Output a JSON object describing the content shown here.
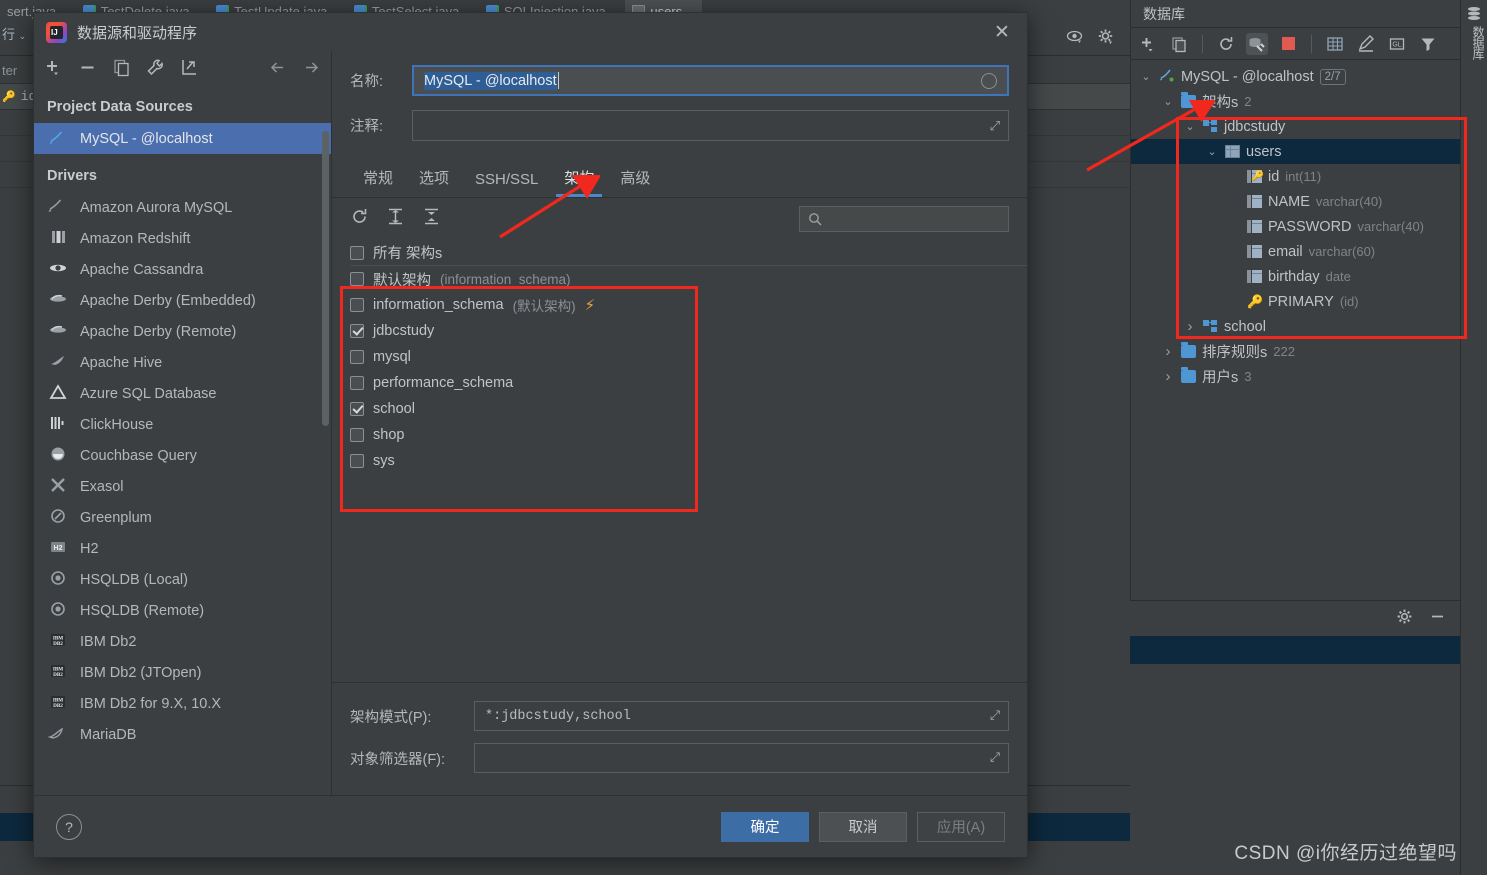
{
  "ide": {
    "editor_tabs": [
      {
        "label": "sert.java",
        "icon": "java-file-icon",
        "active": false
      },
      {
        "label": "TestDelete.java",
        "icon": "java-file-icon",
        "active": false
      },
      {
        "label": "TestUpdate.java",
        "icon": "java-file-icon",
        "active": false
      },
      {
        "label": "TestSelect.java",
        "icon": "java-file-icon",
        "active": false
      },
      {
        "label": "SQLInjection.java",
        "icon": "java-file-icon",
        "active": false
      },
      {
        "label": "users",
        "icon": "table-icon",
        "active": true
      }
    ],
    "grid_behind": {
      "rows_label": "行",
      "filter_label": "ter",
      "column": "id"
    }
  },
  "db_panel": {
    "title": "数据库",
    "rail_label": "数据库",
    "head_icons": [
      "locate-icon",
      "expand-all-icon",
      "collapse-all-icon",
      "gear-icon",
      "minimize-icon"
    ],
    "toolbar_icons": [
      "add-icon",
      "copy-icon",
      "refresh-icon",
      "datasource-properties-icon",
      "stop-icon",
      "table-editor-icon",
      "edit-icon",
      "query-console-icon",
      "filter-icon"
    ],
    "tree": [
      {
        "depth": 0,
        "twisty": "down",
        "icon": "mysql-icon",
        "label": "MySQL - @localhost",
        "badge": "2/7",
        "selected": false
      },
      {
        "depth": 1,
        "twisty": "down",
        "icon": "folder-icon",
        "label": "架构s",
        "sub": "2",
        "selected": false
      },
      {
        "depth": 2,
        "twisty": "down",
        "icon": "schema-icon",
        "label": "jdbcstudy",
        "selected": false
      },
      {
        "depth": 3,
        "twisty": "down",
        "icon": "table-icon",
        "label": "users",
        "selected": true
      },
      {
        "depth": 4,
        "twisty": "none",
        "icon": "primary-key-column-icon",
        "label": "id",
        "sub": "int(11)",
        "selected": false
      },
      {
        "depth": 4,
        "twisty": "none",
        "icon": "column-icon",
        "label": "NAME",
        "sub": "varchar(40)",
        "selected": false
      },
      {
        "depth": 4,
        "twisty": "none",
        "icon": "column-icon",
        "label": "PASSWORD",
        "sub": "varchar(40)",
        "selected": false
      },
      {
        "depth": 4,
        "twisty": "none",
        "icon": "column-icon",
        "label": "email",
        "sub": "varchar(60)",
        "selected": false
      },
      {
        "depth": 4,
        "twisty": "none",
        "icon": "column-icon",
        "label": "birthday",
        "sub": "date",
        "selected": false
      },
      {
        "depth": 4,
        "twisty": "none",
        "icon": "key-icon",
        "label": "PRIMARY",
        "sub": "(id)",
        "selected": false
      },
      {
        "depth": 2,
        "twisty": "right",
        "icon": "schema-icon",
        "label": "school",
        "selected": false
      },
      {
        "depth": 1,
        "twisty": "right",
        "icon": "folder-icon",
        "label": "排序规则s",
        "sub": "222",
        "selected": false
      },
      {
        "depth": 1,
        "twisty": "right",
        "icon": "folder-icon",
        "label": "用户s",
        "sub": "3",
        "selected": false
      }
    ]
  },
  "dialog": {
    "title": "数据源和驱动程序",
    "close_label": "✕",
    "left": {
      "toolbar_icons": [
        "add-icon",
        "remove-icon",
        "copy-icon",
        "wrench-icon",
        "import-icon",
        "back-arrow-icon",
        "forward-arrow-icon"
      ],
      "project_header": "Project Data Sources",
      "datasources": [
        {
          "label": "MySQL - @localhost",
          "icon": "mysql-icon",
          "selected": true
        }
      ],
      "drivers_header": "Drivers",
      "drivers": [
        {
          "label": "Amazon Aurora MySQL",
          "icon": "mysql-dolphin-icon"
        },
        {
          "label": "Amazon Redshift",
          "icon": "redshift-icon"
        },
        {
          "label": "Apache Cassandra",
          "icon": "cassandra-icon"
        },
        {
          "label": "Apache Derby (Embedded)",
          "icon": "derby-icon"
        },
        {
          "label": "Apache Derby (Remote)",
          "icon": "derby-icon"
        },
        {
          "label": "Apache Hive",
          "icon": "hive-icon"
        },
        {
          "label": "Azure SQL Database",
          "icon": "azure-icon"
        },
        {
          "label": "ClickHouse",
          "icon": "clickhouse-icon"
        },
        {
          "label": "Couchbase Query",
          "icon": "couchbase-icon"
        },
        {
          "label": "Exasol",
          "icon": "exasol-icon"
        },
        {
          "label": "Greenplum",
          "icon": "greenplum-icon"
        },
        {
          "label": "H2",
          "icon": "h2-icon"
        },
        {
          "label": "HSQLDB (Local)",
          "icon": "hsqldb-icon"
        },
        {
          "label": "HSQLDB (Remote)",
          "icon": "hsqldb-icon"
        },
        {
          "label": "IBM Db2",
          "icon": "db2-icon"
        },
        {
          "label": "IBM Db2 (JTOpen)",
          "icon": "db2-icon"
        },
        {
          "label": "IBM Db2 for 9.X, 10.X",
          "icon": "db2-icon"
        },
        {
          "label": "MariaDB",
          "icon": "mariadb-icon"
        }
      ]
    },
    "form": {
      "name_label": "名称:",
      "name_value": "MySQL - @localhost",
      "comment_label": "注释:",
      "comment_value": ""
    },
    "tabs": [
      {
        "label": "常规",
        "active": false
      },
      {
        "label": "选项",
        "active": false
      },
      {
        "label": "SSH/SSL",
        "active": false
      },
      {
        "label": "架构",
        "active": true
      },
      {
        "label": "高级",
        "active": false
      }
    ],
    "schema_toolbar": {
      "icons": [
        "refresh-icon",
        "expand-all-icon",
        "collapse-all-icon"
      ],
      "search_placeholder": ""
    },
    "schemas": [
      {
        "label": "所有 架构s",
        "checked": false,
        "sub": "",
        "bolt": false,
        "divider": true
      },
      {
        "label": "默认架构",
        "checked": false,
        "sub": "(information_schema)",
        "bolt": false,
        "divider": false
      },
      {
        "label": "information_schema",
        "checked": false,
        "sub": "(默认架构)",
        "bolt": true,
        "divider": false
      },
      {
        "label": "jdbcstudy",
        "checked": true,
        "sub": "",
        "bolt": false,
        "divider": false
      },
      {
        "label": "mysql",
        "checked": false,
        "sub": "",
        "bolt": false,
        "divider": false
      },
      {
        "label": "performance_schema",
        "checked": false,
        "sub": "",
        "bolt": false,
        "divider": false
      },
      {
        "label": "school",
        "checked": true,
        "sub": "",
        "bolt": false,
        "divider": false
      },
      {
        "label": "shop",
        "checked": false,
        "sub": "",
        "bolt": false,
        "divider": false
      },
      {
        "label": "sys",
        "checked": false,
        "sub": "",
        "bolt": false,
        "divider": false
      }
    ],
    "bottom_fields": {
      "pattern_label": "架构模式(P):",
      "pattern_value": "*:jdbcstudy,school",
      "filter_label": "对象筛选器(F):",
      "filter_value": ""
    },
    "footer": {
      "help_label": "?",
      "ok_label": "确定",
      "cancel_label": "取消",
      "apply_label": "应用(A)"
    }
  },
  "watermark": "CSDN @i你经历过绝望吗",
  "colors": {
    "dialog_bg": "#3c3f41",
    "selection_blue": "#4b6eaf",
    "tree_selection": "#0d293e",
    "accent_tab": "#4a88c7",
    "primary_button": "#3c6ea5",
    "annotation_red": "#f0281e",
    "bolt_orange": "#f0a33a",
    "key_orange": "#e8a33d"
  }
}
